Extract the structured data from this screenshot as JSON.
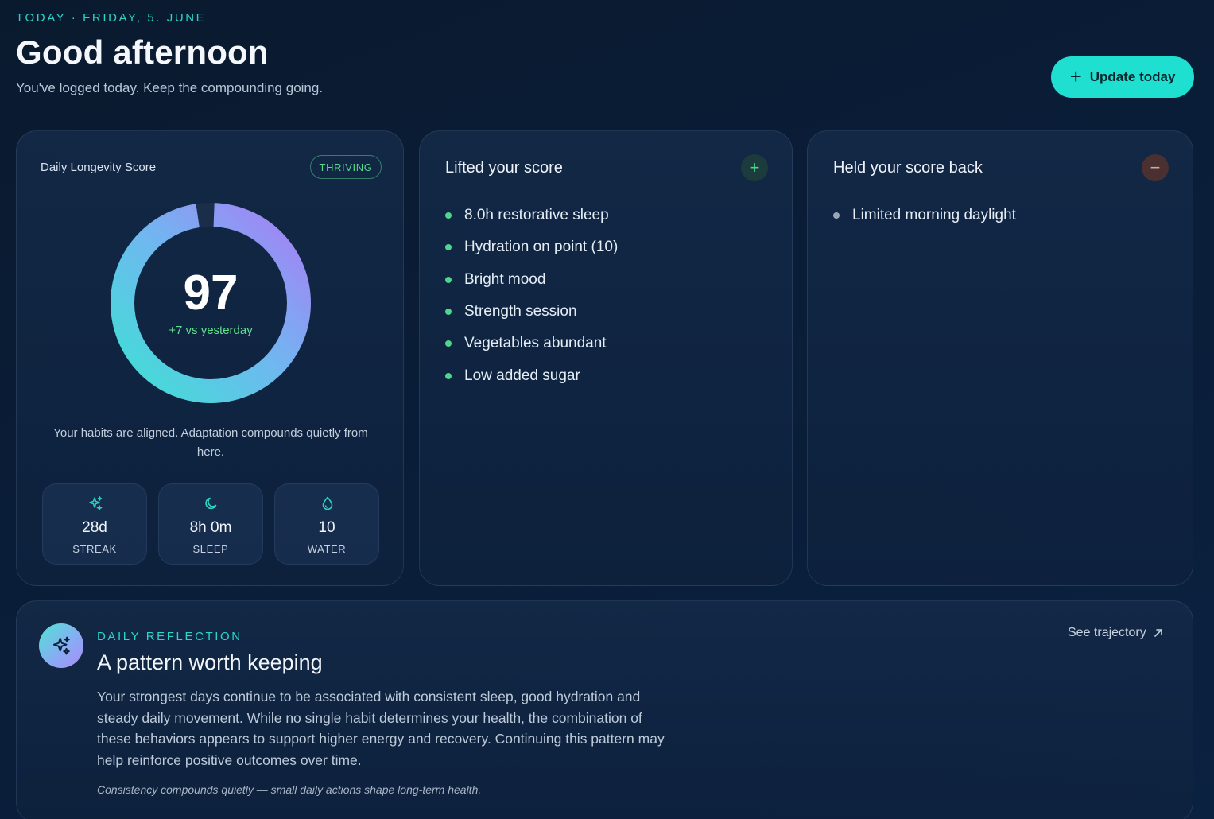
{
  "header": {
    "eyebrow": "TODAY · FRIDAY, 5. JUNE",
    "title": "Good afternoon",
    "subtitle": "You've logged today. Keep the compounding going.",
    "update_button": "Update today"
  },
  "score_card": {
    "label": "Daily Longevity Score",
    "badge": "THRIVING",
    "score": "97",
    "score_fraction": 0.97,
    "delta": "+7 vs yesterday",
    "message": "Your habits are aligned. Adaptation compounds quietly from here.",
    "stats": [
      {
        "value": "28d",
        "label": "STREAK",
        "icon": "sparkles-icon"
      },
      {
        "value": "8h 0m",
        "label": "SLEEP",
        "icon": "moon-icon"
      },
      {
        "value": "10",
        "label": "WATER",
        "icon": "droplet-icon"
      }
    ]
  },
  "lifted": {
    "title": "Lifted your score",
    "items": [
      "8.0h restorative sleep",
      "Hydration on point (10)",
      "Bright mood",
      "Strength session",
      "Vegetables abundant",
      "Low added sugar"
    ]
  },
  "held": {
    "title": "Held your score back",
    "items": [
      "Limited morning daylight"
    ]
  },
  "reflection": {
    "eyebrow": "DAILY REFLECTION",
    "title": "A pattern worth keeping",
    "body": "Your strongest days continue to be associated with consistent sleep, good hydration and steady daily movement. While no single habit determines your health, the combination of these behaviors appears to support higher energy and recovery. Continuing this pattern may help reinforce positive outcomes over time.",
    "quote": "Consistency compounds quietly — small daily actions shape long-term health.",
    "link": "See trajectory"
  },
  "colors": {
    "accent": "#1fe0d0",
    "positive": "#4ed68b",
    "ring_start": "#3ee0d4",
    "ring_end": "#a67ff5"
  }
}
